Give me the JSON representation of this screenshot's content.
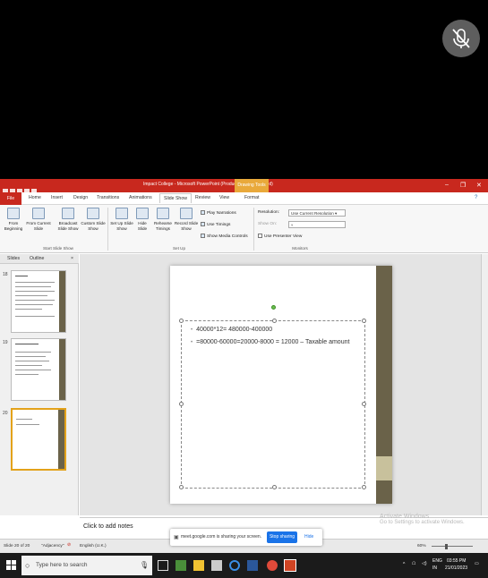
{
  "window": {
    "title": "Impact College - Microsoft PowerPoint (Product Activation Failed)",
    "contextual_tab": "Drawing Tools"
  },
  "tabs": [
    "File",
    "Home",
    "Insert",
    "Design",
    "Transitions",
    "Animations",
    "Slide Show",
    "Review",
    "View",
    "Format"
  ],
  "active_tab": "Slide Show",
  "ribbon": {
    "start_group": {
      "label": "Start Slide Show",
      "buttons": [
        "From Beginning",
        "From Current Slide",
        "Broadcast Slide Show",
        "Custom Slide Show"
      ]
    },
    "setup_group": {
      "label": "Set Up",
      "buttons": [
        "Set Up Slide Show",
        "Hide Slide",
        "Rehearse Timings",
        "Record Slide Show"
      ],
      "checkboxes": [
        {
          "label": "Play Narrations",
          "checked": true
        },
        {
          "label": "Use Timings",
          "checked": true
        },
        {
          "label": "Show Media Controls",
          "checked": true
        }
      ]
    },
    "monitors_group": {
      "label": "Monitors",
      "resolution_label": "Resolution:",
      "resolution_value": "Use Current Resolution",
      "show_on_label": "Show On:",
      "presenter_view_label": "Use Presenter View"
    }
  },
  "left_pane": {
    "tabs": [
      "Slides",
      "Outline"
    ],
    "close": "×",
    "slide_numbers": [
      "18",
      "19",
      "20"
    ],
    "selected_slide": "20"
  },
  "slide": {
    "lines": [
      "40000*12= 480000-400000",
      "=80000-60000=20000-8000 = 12000 – Taxable amount"
    ]
  },
  "notes": {
    "placeholder": "Click to add notes"
  },
  "status": {
    "slide_info": "Slide 20 of 20",
    "theme": "\"Adjacency\"",
    "language": "English (U.K.)",
    "zoom": "60%"
  },
  "share_banner": {
    "text": "meet.google.com is sharing your screen.",
    "stop": "Stop sharing",
    "hide": "Hide"
  },
  "watermark": {
    "line1": "Activate Windows",
    "line2": "Go to Settings to activate Windows."
  },
  "taskbar": {
    "search_placeholder": "Type here to search",
    "lang_top": "ENG",
    "lang_bottom": "IN",
    "time": "03:55 PM",
    "date": "21/01/2023"
  },
  "colors": {
    "title_bar": "#c8281e",
    "drawing_tools": "#e9a93b",
    "slide_stripe": "#6a6249",
    "meet_blue": "#1a73e8"
  }
}
